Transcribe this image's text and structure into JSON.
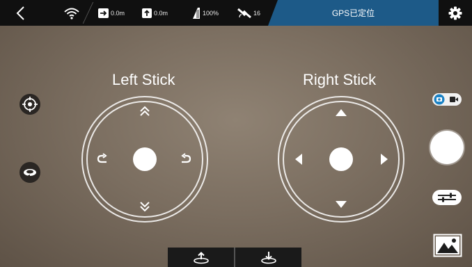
{
  "topbar": {
    "back_icon": "chevron-left-icon",
    "wifi_icon": "wifi-icon",
    "distance": "0.0m",
    "altitude": "0.0m",
    "battery": "100%",
    "satellites": "16",
    "gps_status": "GPS已定位",
    "settings_icon": "gear-icon"
  },
  "left_stick": {
    "title": "Left Stick"
  },
  "right_stick": {
    "title": "Right Stick"
  },
  "left_tools": [
    "crosshair-target-icon",
    "orbit-icon"
  ],
  "right_tools": [
    "photo-video-toggle-icon",
    "shutter-button",
    "sliders-icon",
    "gallery-icon"
  ],
  "bottom_bar": [
    "takeoff-icon",
    "landing-icon"
  ],
  "colors": {
    "topbar": "#101010",
    "gps_panel": "#1d5a88"
  }
}
